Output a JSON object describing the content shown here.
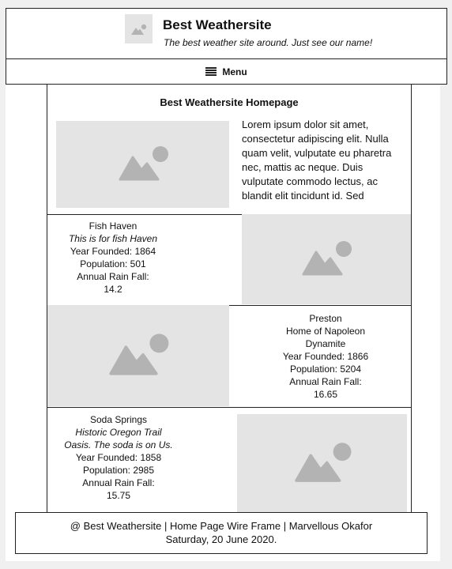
{
  "header": {
    "logo_icon": "image-placeholder-icon",
    "title": "Best Weathersite",
    "tagline": "The best weather site around. Just see our name!"
  },
  "nav": {
    "menu_icon": "hamburger-icon",
    "menu_label": "Menu"
  },
  "main": {
    "title": "Best Weathersite Homepage",
    "intro_text": "Lorem ipsum dolor sit amet, consectetur adipiscing elit. Nulla quam velit, vulputate eu pharetra nec, mattis ac neque. Duis vulputate commodo lectus, ac blandit elit tincidunt id. Sed",
    "towns": [
      {
        "name": "Fish Haven",
        "motto": "This is for fish Haven",
        "year_founded": "Year Founded: 1864",
        "population": "Population: 501",
        "rain_label": "Annual Rain Fall:",
        "rain_value": "14.2"
      },
      {
        "name": "Preston",
        "motto": "Home of Napoleon Dynamite",
        "year_founded": "Year Founded: 1866",
        "population": "Population: 5204",
        "rain_label": "Annual Rain Fall:",
        "rain_value": "16.65"
      },
      {
        "name": "Soda Springs",
        "motto": "Historic Oregon Trail Oasis. The soda is on Us.",
        "year_founded": "Year Founded: 1858",
        "population": "Population: 2985",
        "rain_label": "Annual Rain Fall:",
        "rain_value": "15.75"
      }
    ]
  },
  "footer": {
    "line1": "@ Best Weathersite | Home Page Wire Frame | Marvellous Okafor",
    "line2": "Saturday, 20 June 2020."
  },
  "colors": {
    "placeholder_bg": "#e4e4e4",
    "placeholder_icon": "#b3b3b3",
    "border": "#222222"
  }
}
